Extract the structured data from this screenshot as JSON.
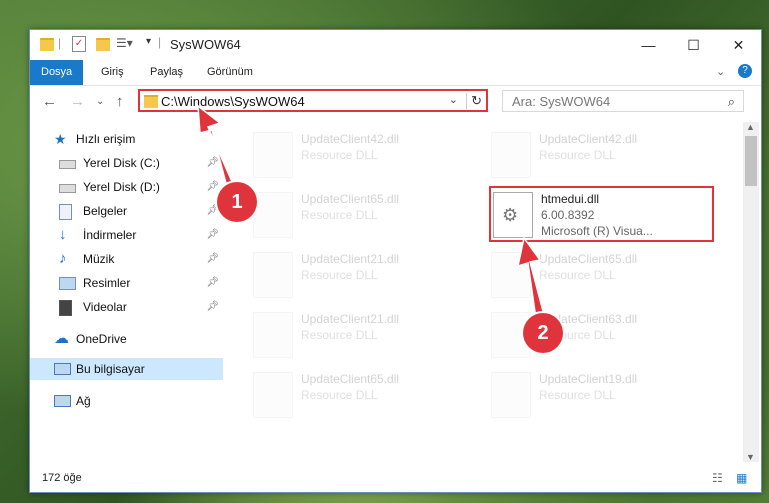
{
  "window": {
    "title": "SysWOW64"
  },
  "ribbon": {
    "tabs": [
      "Dosya",
      "Giriş",
      "Paylaş",
      "Görünüm"
    ]
  },
  "address": {
    "path": "C:\\Windows\\SysWOW64",
    "search_placeholder": "Ara: SysWOW64"
  },
  "sidebar": {
    "items": [
      {
        "label": "Hızlı erişim",
        "icon": "star-icon"
      },
      {
        "label": "Yerel Disk (C:)",
        "icon": "drive-icon"
      },
      {
        "label": "Yerel Disk (D:)",
        "icon": "drive-icon"
      },
      {
        "label": "Belgeler",
        "icon": "documents-icon"
      },
      {
        "label": "İndirmeler",
        "icon": "download-icon"
      },
      {
        "label": "Müzik",
        "icon": "music-icon"
      },
      {
        "label": "Resimler",
        "icon": "pictures-icon"
      },
      {
        "label": "Videolar",
        "icon": "video-icon"
      },
      {
        "label": "OneDrive",
        "icon": "cloud-icon"
      },
      {
        "label": "Bu bilgisayar",
        "icon": "computer-icon"
      },
      {
        "label": "Ağ",
        "icon": "network-icon"
      }
    ]
  },
  "files": [
    {
      "name": "UpdateClient42.dll",
      "sub1": "Resource DLL"
    },
    {
      "name": "UpdateClient42.dll",
      "sub1": "Resource DLL"
    },
    {
      "name": "UpdateClient65.dll",
      "sub1": "Resource DLL"
    },
    {
      "name": "htmedui.dll",
      "sub1": "6.00.8392",
      "sub2": "Microsoft (R) Visua..."
    },
    {
      "name": "UpdateClient21.dll",
      "sub1": "Resource DLL"
    },
    {
      "name": "UpdateClient65.dll",
      "sub1": "Resource DLL"
    },
    {
      "name": "UpdateClient21.dll",
      "sub1": "Resource DLL"
    },
    {
      "name": "UpdateClient63.dll",
      "sub1": "Resource DLL"
    },
    {
      "name": "UpdateClient65.dll",
      "sub1": "Resource DLL"
    },
    {
      "name": "UpdateClient19.dll",
      "sub1": "Resource DLL"
    }
  ],
  "status": {
    "count": "172 öğe"
  },
  "annotations": {
    "badge1": "1",
    "badge2": "2"
  },
  "colors": {
    "highlight": "#e0343c",
    "file_tab": "#1979ca"
  }
}
